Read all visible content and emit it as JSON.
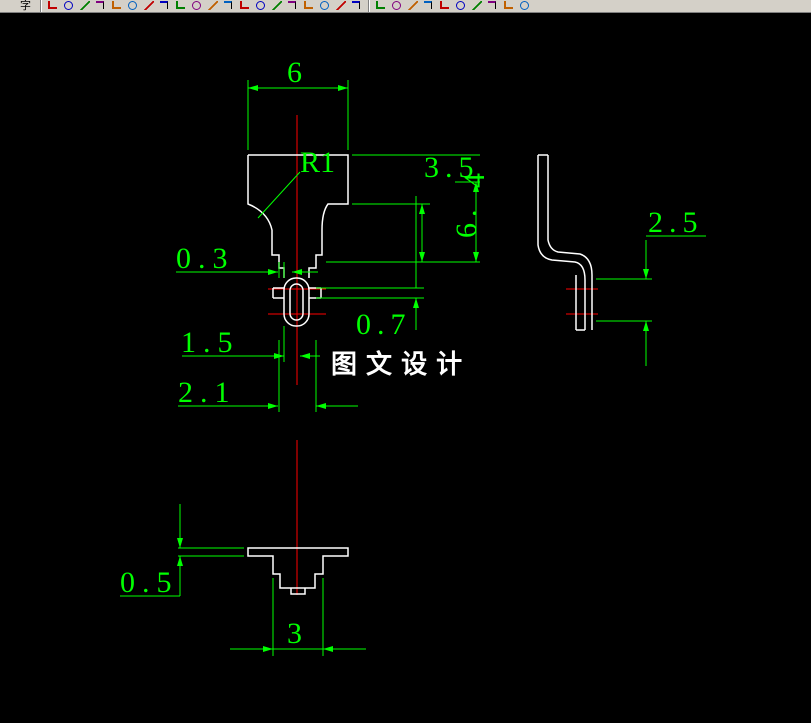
{
  "toolbar": {
    "title_glyph": "字",
    "icons": [
      "grid-snap-icon",
      "layer-icon",
      "print-icon",
      "line-icon",
      "circle-icon",
      "hatch-icon",
      "insert-icon",
      "pipe-icon",
      "block-icon",
      "curve-icon",
      "pencil-icon",
      "joint-icon",
      "cross-icon",
      "gear-icon",
      "target-icon",
      "marker-icon",
      "column-icon",
      "tee-icon",
      "dimension-icon",
      "angle-icon",
      "square-icon",
      "arrow-icon",
      "mirror-icon",
      "frame-icon",
      "hatch-alt-icon",
      "diagonal-icon",
      "xline-icon",
      "fan-icon",
      "arc-icon",
      "zigzag-icon"
    ]
  },
  "drawing": {
    "dimensions": {
      "top_width": "6",
      "radius": "R1",
      "height_a": "3.5",
      "height_b": "4",
      "height_c": "6.",
      "neck": "0.3",
      "gap": "0.7",
      "slot": "1.5",
      "outer": "2.1",
      "side_offset": "2.5",
      "thickness": "0.5",
      "bottom_width": "3"
    },
    "watermark": "图 文 设 计"
  },
  "colors": {
    "background": "#000000",
    "outline": "#ffffff",
    "dimension": "#00ff00",
    "centerline": "#ff0000"
  }
}
